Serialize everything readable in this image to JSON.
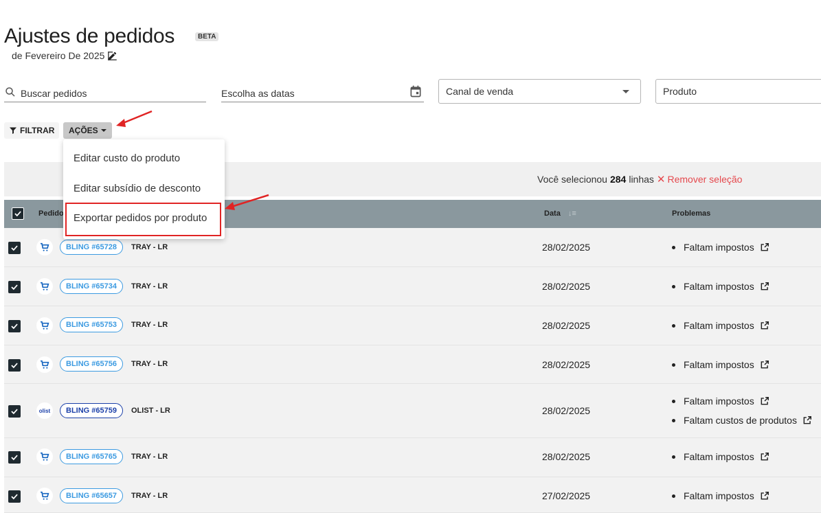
{
  "header": {
    "title": "Ajustes de pedidos",
    "badge": "BETA",
    "period": "de Fevereiro De 2025"
  },
  "filters": {
    "search_placeholder": "Buscar pedidos",
    "date_placeholder": "Escolha as datas",
    "channel_label": "Canal de venda",
    "product_label": "Produto"
  },
  "toolbar": {
    "filter_label": "FILTRAR",
    "actions_label": "AÇÕES"
  },
  "actions_menu": {
    "items": [
      "Editar custo do produto",
      "Editar subsídio de desconto",
      "Exportar pedidos por produto"
    ]
  },
  "selection": {
    "prefix": "Você selecionou",
    "count": "284",
    "suffix": "linhas",
    "remove_label": "Remover seleção"
  },
  "table": {
    "columns": {
      "orders": "Pedidos",
      "date": "Data",
      "problems": "Problemas"
    },
    "rows": [
      {
        "platform": "cart-icon",
        "order": "BLING #65728",
        "store": "TRAY - LR",
        "date": "28/02/2025",
        "problems": [
          "Faltam impostos"
        ]
      },
      {
        "platform": "cart-icon",
        "order": "BLING #65734",
        "store": "TRAY - LR",
        "date": "28/02/2025",
        "problems": [
          "Faltam impostos"
        ]
      },
      {
        "platform": "cart-icon",
        "order": "BLING #65753",
        "store": "TRAY - LR",
        "date": "28/02/2025",
        "problems": [
          "Faltam impostos"
        ]
      },
      {
        "platform": "cart-icon",
        "order": "BLING #65756",
        "store": "TRAY - LR",
        "date": "28/02/2025",
        "problems": [
          "Faltam impostos"
        ]
      },
      {
        "platform": "olist",
        "order": "BLING #65759",
        "store": "OLIST - LR",
        "date": "28/02/2025",
        "problems": [
          "Faltam impostos",
          "Faltam custos de produtos"
        ]
      },
      {
        "platform": "cart-icon",
        "order": "BLING #65765",
        "store": "TRAY - LR",
        "date": "28/02/2025",
        "problems": [
          "Faltam impostos"
        ]
      },
      {
        "platform": "cart-icon",
        "order": "BLING #65657",
        "store": "TRAY - LR",
        "date": "27/02/2025",
        "problems": [
          "Faltam impostos"
        ]
      }
    ]
  },
  "colors": {
    "header_bg": "#8a989e",
    "pill_blue": "#3b9ae1",
    "pill_dark": "#1a3fa8",
    "highlight": "#e02424"
  }
}
